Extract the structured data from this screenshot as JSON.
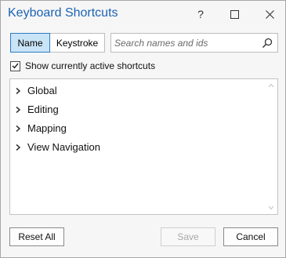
{
  "window": {
    "title": "Keyboard Shortcuts",
    "help_label": "?"
  },
  "toolbar": {
    "name_label": "Name",
    "keystroke_label": "Keystroke",
    "selected": "Name"
  },
  "search": {
    "placeholder": "Search names and ids",
    "value": ""
  },
  "options": {
    "show_active_label": "Show currently active shortcuts",
    "show_active_checked": true
  },
  "tree": {
    "items": [
      {
        "label": "Global"
      },
      {
        "label": "Editing"
      },
      {
        "label": "Mapping"
      },
      {
        "label": "View Navigation"
      }
    ]
  },
  "footer": {
    "reset_label": "Reset All",
    "save_label": "Save",
    "save_enabled": false,
    "cancel_label": "Cancel"
  },
  "colors": {
    "title": "#1b64b4",
    "selected_toggle_bg": "#c9e4f7",
    "selected_toggle_border": "#2f7cc4"
  },
  "icons": [
    "help-icon",
    "maximize-icon",
    "close-icon",
    "search-icon",
    "check-icon",
    "chevron-right-icon",
    "scroll-up-icon",
    "scroll-down-icon"
  ]
}
